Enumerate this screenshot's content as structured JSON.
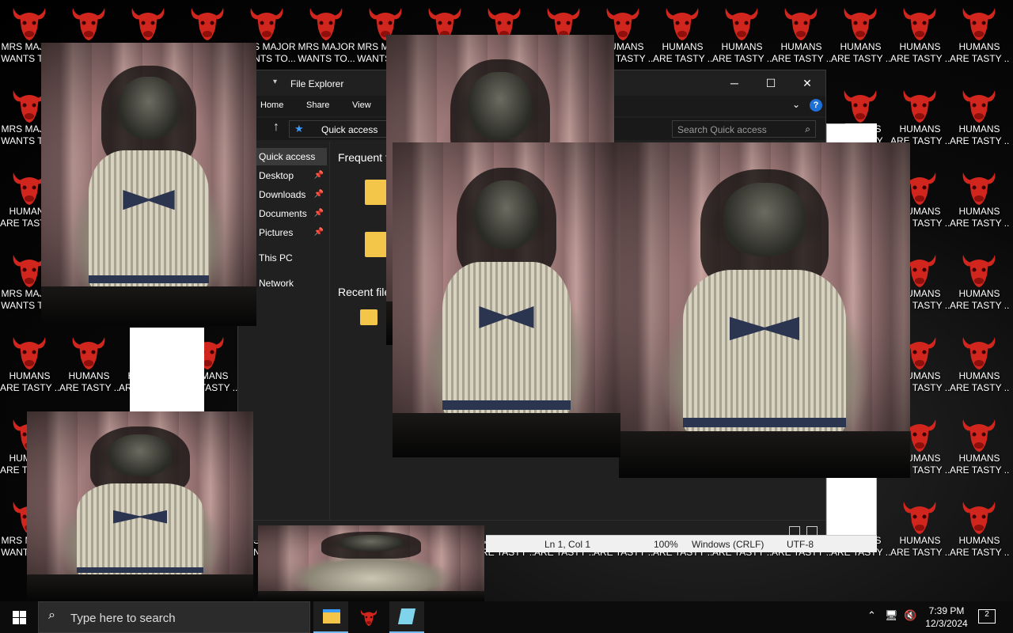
{
  "desktop": {
    "icon_labels": {
      "humans": [
        "HUMANS",
        "ARE TASTY ..."
      ],
      "mrs": [
        "MRS MAJOR",
        "WANTS TO..."
      ]
    },
    "visible_labels": [
      {
        "l1": "MRS MA",
        "l2": "WANTS T"
      },
      {
        "l1": "HUMANS",
        "l2": "ARE TASTY ..."
      },
      {
        "l1": "MRS MAJOR",
        "l2": "WANTS TO..."
      },
      {
        "l1": "MRS M",
        "l2": "WANT"
      }
    ],
    "background_color": "#000000"
  },
  "explorer": {
    "title": "File Explorer",
    "ribbon_tabs": [
      "Home",
      "Share",
      "View"
    ],
    "address_crumb": "Quick access",
    "search_placeholder": "Search Quick access",
    "nav_items": [
      {
        "label": "Quick access",
        "pinned": false
      },
      {
        "label": "Desktop",
        "pinned": true
      },
      {
        "label": "Downloads",
        "pinned": true
      },
      {
        "label": "Documents",
        "pinned": true
      },
      {
        "label": "Pictures",
        "pinned": true
      },
      {
        "label": "This PC",
        "pinned": false
      },
      {
        "label": "Network",
        "pinned": false
      }
    ],
    "groups": [
      "Frequent folders",
      "Recent files"
    ],
    "help_label": "?"
  },
  "notepad": {
    "position": "Ln 1, Col 1",
    "zoom": "100%",
    "line_ending": "Windows (CRLF)",
    "encoding": "UTF-8"
  },
  "taskbar": {
    "search_placeholder": "Type here to search",
    "time": "7:39 PM",
    "date": "12/3/2024",
    "notification_count": "2"
  },
  "colors": {
    "bull_red": "#d0261e",
    "accent_blue": "#1e6fd6",
    "taskbar": "#0c0c0c"
  }
}
